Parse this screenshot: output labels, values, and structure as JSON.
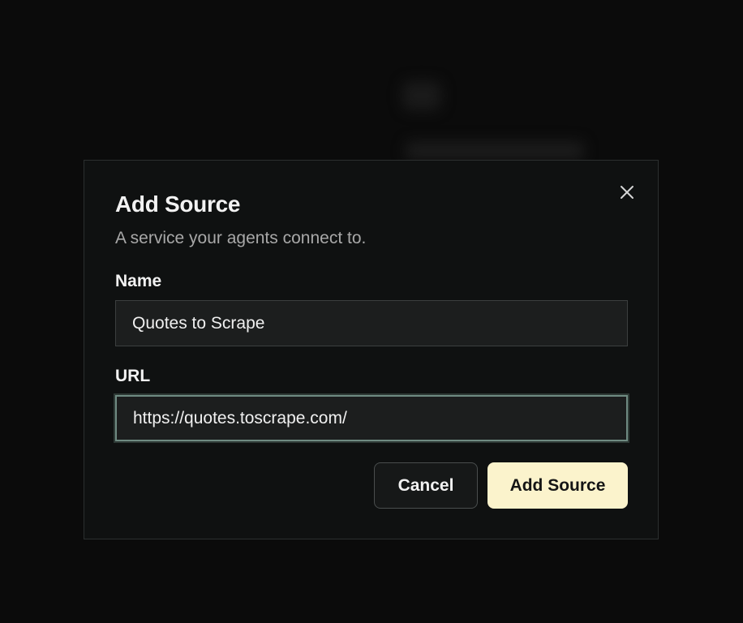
{
  "dialog": {
    "title": "Add Source",
    "subtitle": "A service your agents connect to.",
    "close_icon": "close-icon"
  },
  "form": {
    "name_label": "Name",
    "name_value": "Quotes to Scrape",
    "url_label": "URL",
    "url_value": "https://quotes.toscrape.com/"
  },
  "actions": {
    "cancel_label": "Cancel",
    "submit_label": "Add Source"
  },
  "colors": {
    "background": "#0b0b0b",
    "dialog": "#0f1111",
    "accent_button": "#fbf3cc",
    "focus_border": "#6f8b82"
  }
}
